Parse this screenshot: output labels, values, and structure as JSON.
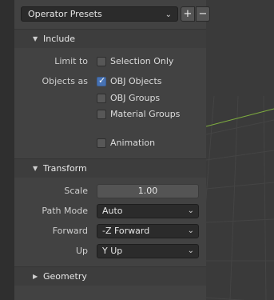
{
  "presets": {
    "label": "Operator Presets",
    "add_symbol": "+",
    "remove_symbol": "−"
  },
  "include": {
    "title": "Include",
    "limit_to_label": "Limit to",
    "objects_as_label": "Objects as",
    "checkboxes": [
      {
        "label": "Selection Only",
        "checked": false
      },
      {
        "label": "OBJ Objects",
        "checked": true
      },
      {
        "label": "OBJ Groups",
        "checked": false
      },
      {
        "label": "Material Groups",
        "checked": false
      },
      {
        "label": "Animation",
        "checked": false
      }
    ]
  },
  "transform": {
    "title": "Transform",
    "scale_label": "Scale",
    "scale_value": "1.00",
    "path_mode_label": "Path Mode",
    "path_mode_value": "Auto",
    "forward_label": "Forward",
    "forward_value": "-Z Forward",
    "up_label": "Up",
    "up_value": "Y Up"
  },
  "geometry": {
    "title": "Geometry"
  },
  "colors": {
    "accent": "#4772b3",
    "x_axis_line": "#7fae3f"
  },
  "icons": {
    "expanded": "▼",
    "collapsed": "▶",
    "dropdown": "⌄",
    "check": "✓"
  }
}
